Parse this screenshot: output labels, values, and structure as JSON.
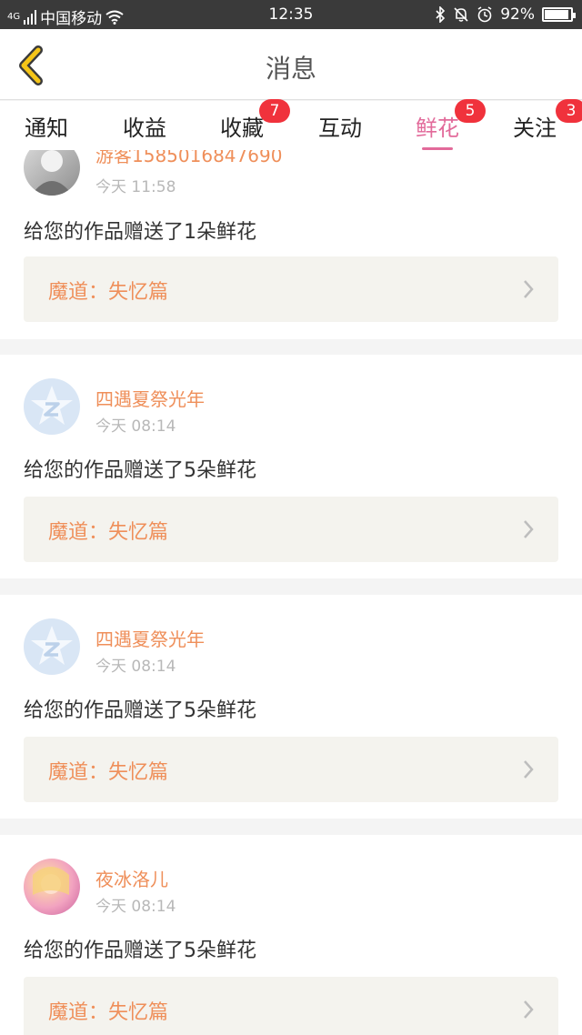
{
  "status_bar": {
    "network": "4G",
    "carrier": "中国移动",
    "time": "12:35",
    "battery": "92%",
    "battery_level": 0.92
  },
  "header": {
    "title": "消息",
    "back_icon": "chevron-left-icon",
    "accent_color": "#f5c518"
  },
  "tabs": [
    {
      "label": "通知",
      "badge": ""
    },
    {
      "label": "收益",
      "badge": ""
    },
    {
      "label": "收藏",
      "badge": "7"
    },
    {
      "label": "互动",
      "badge": ""
    },
    {
      "label": "鲜花",
      "badge": "5",
      "active": true
    },
    {
      "label": "关注",
      "badge": "3"
    }
  ],
  "colors": {
    "active_tab": "#e26a9a",
    "badge": "#f0323c",
    "username": "#ef8f5a"
  },
  "messages": [
    {
      "user": "游客15850168476​90",
      "time": "今天 11:58",
      "text": "给您的作品赠送了1朵鲜花",
      "work": "魔道：失忆篇"
    },
    {
      "user": "四遇夏祭光年",
      "time": "今天 08:14",
      "text": "给您的作品赠送了5朵鲜花",
      "work": "魔道：失忆篇"
    },
    {
      "user": "四遇夏祭光年",
      "time": "今天 08:14",
      "text": "给您的作品赠送了5朵鲜花",
      "work": "魔道：失忆篇"
    },
    {
      "user": "夜冰洛儿",
      "time": "今天 08:14",
      "text": "给您的作品赠送了5朵鲜花",
      "work": "魔道：失忆篇"
    }
  ]
}
